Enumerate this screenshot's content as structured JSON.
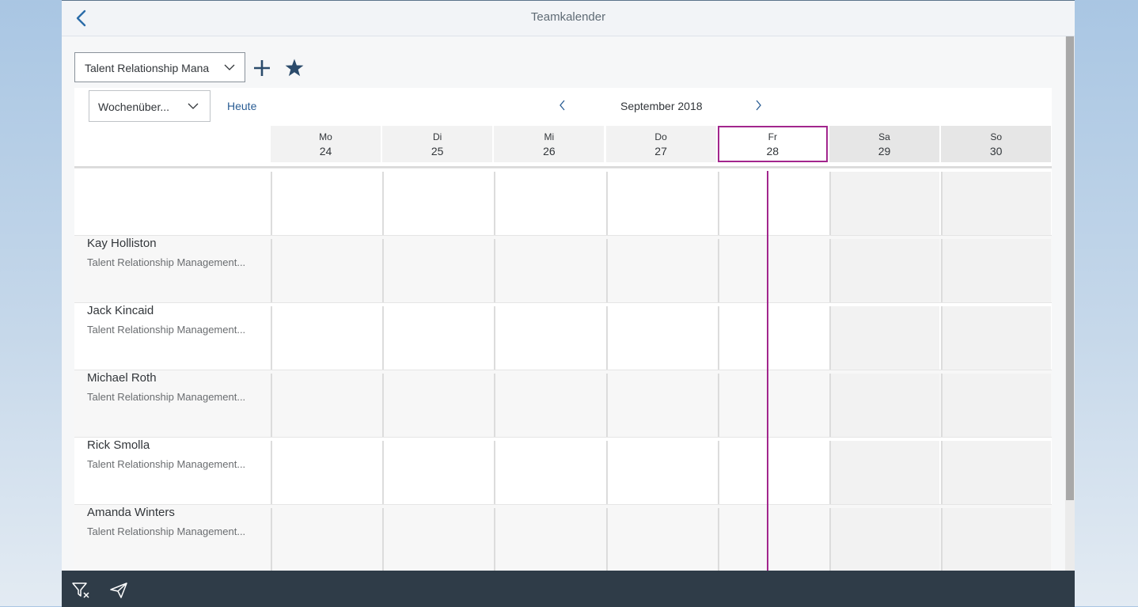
{
  "header": {
    "title": "Teamkalender"
  },
  "toolbar": {
    "team_select_value": "Talent Relationship Mana"
  },
  "calendar": {
    "view_select_value": "Wochenüber...",
    "today_label": "Heute",
    "month_label": "September 2018",
    "days": [
      {
        "name": "Mo",
        "num": "24"
      },
      {
        "name": "Di",
        "num": "25"
      },
      {
        "name": "Mi",
        "num": "26"
      },
      {
        "name": "Do",
        "num": "27"
      },
      {
        "name": "Fr",
        "num": "28"
      },
      {
        "name": "Sa",
        "num": "29"
      },
      {
        "name": "So",
        "num": "30"
      }
    ],
    "today_index": 4,
    "weekend_indices": [
      5,
      6
    ],
    "people": [
      {
        "name": "",
        "role": ""
      },
      {
        "name": "Kay Holliston",
        "role": "Talent Relationship Management..."
      },
      {
        "name": "Jack Kincaid",
        "role": "Talent Relationship Management..."
      },
      {
        "name": "Michael Roth",
        "role": "Talent Relationship Management..."
      },
      {
        "name": "Rick Smolla",
        "role": "Talent Relationship Management..."
      },
      {
        "name": "Amanda Winters",
        "role": "Talent Relationship Management..."
      }
    ]
  },
  "colors": {
    "accent": "#a2268d",
    "link": "#2a5d94",
    "footer": "#2f3c48",
    "icon": "#2b4b6b"
  },
  "icons": {
    "back": "chevron-left-icon",
    "add": "plus-icon",
    "favorite": "star-icon",
    "filter": "clear-filter-icon",
    "send": "paper-plane-icon"
  }
}
